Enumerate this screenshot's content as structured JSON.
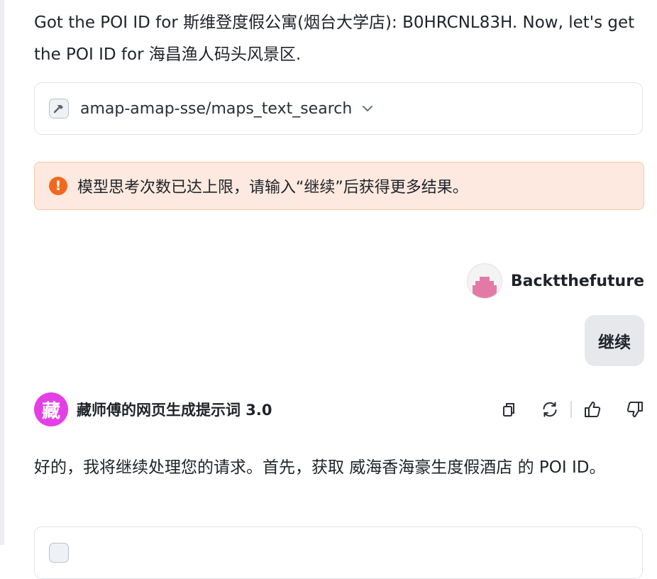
{
  "messages": {
    "assistant_intro": "Got the POI ID for 斯维登度假公寓(烟台大学店): B0HRCNL83H. Now, let's get the POI ID for 海昌渔人码头风景区.",
    "tool_call": {
      "name": "amap-amap-sse/maps_text_search",
      "icon": "hammer-icon"
    },
    "alert": {
      "text": "模型思考次数已达上限，请输入“继续”后获得更多结果。",
      "icon": "exclamation-icon",
      "color": "#f2691e"
    },
    "user": {
      "name": "Backtthefuture",
      "message": "继续"
    },
    "bot": {
      "avatar_char": "藏",
      "avatar_color": "#e43fe6",
      "name": "藏师傅的网页生成提示词 3.0",
      "actions": [
        "copy-icon",
        "regenerate-icon",
        "thumbs-up-icon",
        "thumbs-down-icon"
      ],
      "reply": "好的，我将继续处理您的请求。首先，获取 威海香海豪生度假酒店 的 POI ID。"
    }
  }
}
